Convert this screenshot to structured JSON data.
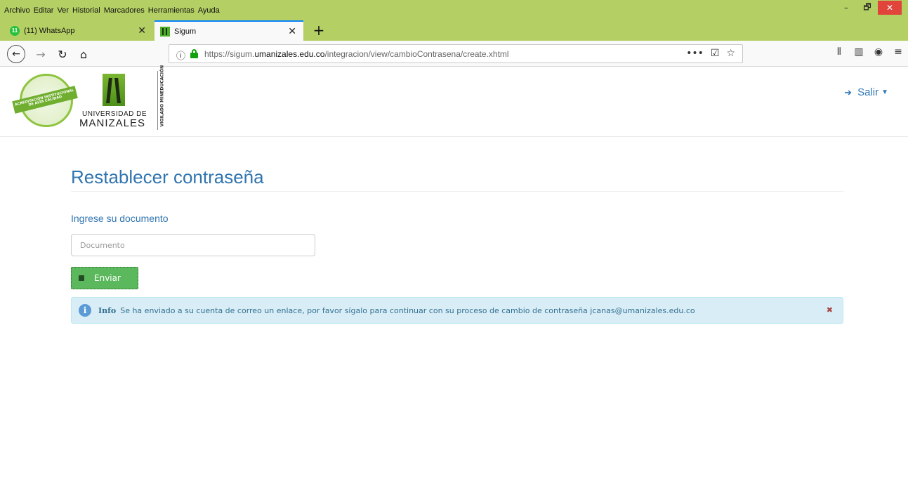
{
  "browser": {
    "menu": [
      "Archivo",
      "Editar",
      "Ver",
      "Historial",
      "Marcadores",
      "Herramientas",
      "Ayuda"
    ],
    "window_controls": {
      "minimize": "–",
      "restore": "🗗",
      "close": "✕"
    },
    "tabs": [
      {
        "title": "(11) WhatsApp",
        "badge": "11",
        "active": false
      },
      {
        "title": "Sigum",
        "active": true
      }
    ],
    "tab_close": "✕",
    "new_tab": "+",
    "url_prefix": "https://sigum.",
    "url_domain": "umanizales.edu.co",
    "url_path": "/integracion/view/cambioContrasena/create.xhtml",
    "url_actions": {
      "more": "•••",
      "pocket": "☑",
      "bookmark": "☆"
    },
    "tools": {
      "library": "⫴",
      "sidebar": "▥",
      "account": "◉",
      "menu": "≡"
    }
  },
  "site": {
    "seal_text": "ACREDITACIÓN INSTITUCIONAL DE ALTA CALIDAD",
    "logo_line1": "UNIVERSIDAD DE",
    "logo_line2": "MANIZALES",
    "vigilado_text": "VIGILADO MINEDUCACIÓN",
    "logout_label": "Salir"
  },
  "form": {
    "heading": "Restablecer contraseña",
    "document_label": "Ingrese su documento",
    "document_placeholder": "Documento",
    "document_value": "",
    "submit_label": "Enviar"
  },
  "alert": {
    "title": "Info",
    "message": "Se ha enviado a su cuenta de correo un enlace, por favor sígalo para continuar con su proceso de cambio de contraseña jcanas@umanizales.edu.co",
    "close": "✖"
  },
  "colors": {
    "firefox_chrome": "#b4cf64",
    "heading_blue": "#3074b0",
    "button_green": "#5cb85c",
    "alert_bg": "#d9edf7"
  }
}
